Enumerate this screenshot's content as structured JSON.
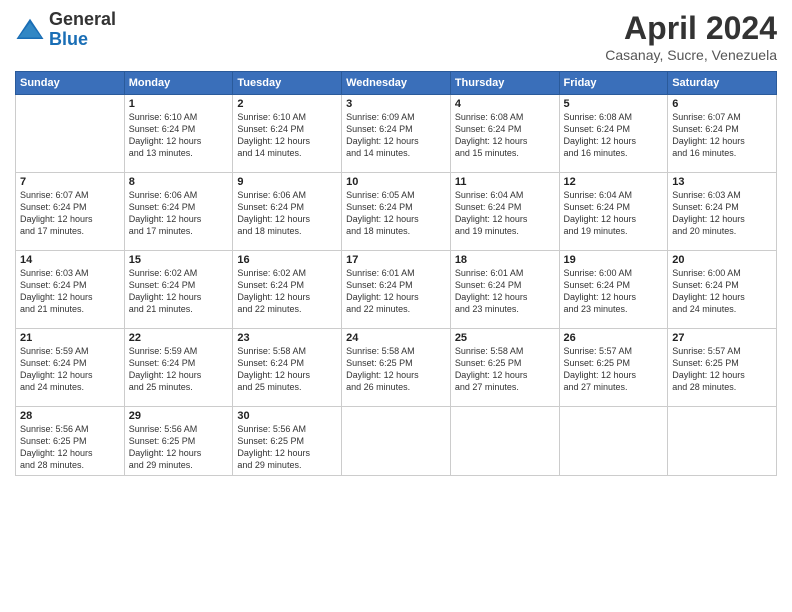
{
  "header": {
    "logo_general": "General",
    "logo_blue": "Blue",
    "title": "April 2024",
    "location": "Casanay, Sucre, Venezuela"
  },
  "weekdays": [
    "Sunday",
    "Monday",
    "Tuesday",
    "Wednesday",
    "Thursday",
    "Friday",
    "Saturday"
  ],
  "weeks": [
    [
      {
        "num": "",
        "empty": true
      },
      {
        "num": "1",
        "sunrise": "6:10 AM",
        "sunset": "6:24 PM",
        "daylight": "12 hours and 13 minutes."
      },
      {
        "num": "2",
        "sunrise": "6:10 AM",
        "sunset": "6:24 PM",
        "daylight": "12 hours and 14 minutes."
      },
      {
        "num": "3",
        "sunrise": "6:09 AM",
        "sunset": "6:24 PM",
        "daylight": "12 hours and 14 minutes."
      },
      {
        "num": "4",
        "sunrise": "6:08 AM",
        "sunset": "6:24 PM",
        "daylight": "12 hours and 15 minutes."
      },
      {
        "num": "5",
        "sunrise": "6:08 AM",
        "sunset": "6:24 PM",
        "daylight": "12 hours and 16 minutes."
      },
      {
        "num": "6",
        "sunrise": "6:07 AM",
        "sunset": "6:24 PM",
        "daylight": "12 hours and 16 minutes."
      }
    ],
    [
      {
        "num": "7",
        "sunrise": "6:07 AM",
        "sunset": "6:24 PM",
        "daylight": "12 hours and 17 minutes."
      },
      {
        "num": "8",
        "sunrise": "6:06 AM",
        "sunset": "6:24 PM",
        "daylight": "12 hours and 17 minutes."
      },
      {
        "num": "9",
        "sunrise": "6:06 AM",
        "sunset": "6:24 PM",
        "daylight": "12 hours and 18 minutes."
      },
      {
        "num": "10",
        "sunrise": "6:05 AM",
        "sunset": "6:24 PM",
        "daylight": "12 hours and 18 minutes."
      },
      {
        "num": "11",
        "sunrise": "6:04 AM",
        "sunset": "6:24 PM",
        "daylight": "12 hours and 19 minutes."
      },
      {
        "num": "12",
        "sunrise": "6:04 AM",
        "sunset": "6:24 PM",
        "daylight": "12 hours and 19 minutes."
      },
      {
        "num": "13",
        "sunrise": "6:03 AM",
        "sunset": "6:24 PM",
        "daylight": "12 hours and 20 minutes."
      }
    ],
    [
      {
        "num": "14",
        "sunrise": "6:03 AM",
        "sunset": "6:24 PM",
        "daylight": "12 hours and 21 minutes."
      },
      {
        "num": "15",
        "sunrise": "6:02 AM",
        "sunset": "6:24 PM",
        "daylight": "12 hours and 21 minutes."
      },
      {
        "num": "16",
        "sunrise": "6:02 AM",
        "sunset": "6:24 PM",
        "daylight": "12 hours and 22 minutes."
      },
      {
        "num": "17",
        "sunrise": "6:01 AM",
        "sunset": "6:24 PM",
        "daylight": "12 hours and 22 minutes."
      },
      {
        "num": "18",
        "sunrise": "6:01 AM",
        "sunset": "6:24 PM",
        "daylight": "12 hours and 23 minutes."
      },
      {
        "num": "19",
        "sunrise": "6:00 AM",
        "sunset": "6:24 PM",
        "daylight": "12 hours and 23 minutes."
      },
      {
        "num": "20",
        "sunrise": "6:00 AM",
        "sunset": "6:24 PM",
        "daylight": "12 hours and 24 minutes."
      }
    ],
    [
      {
        "num": "21",
        "sunrise": "5:59 AM",
        "sunset": "6:24 PM",
        "daylight": "12 hours and 24 minutes."
      },
      {
        "num": "22",
        "sunrise": "5:59 AM",
        "sunset": "6:24 PM",
        "daylight": "12 hours and 25 minutes."
      },
      {
        "num": "23",
        "sunrise": "5:58 AM",
        "sunset": "6:24 PM",
        "daylight": "12 hours and 25 minutes."
      },
      {
        "num": "24",
        "sunrise": "5:58 AM",
        "sunset": "6:25 PM",
        "daylight": "12 hours and 26 minutes."
      },
      {
        "num": "25",
        "sunrise": "5:58 AM",
        "sunset": "6:25 PM",
        "daylight": "12 hours and 27 minutes."
      },
      {
        "num": "26",
        "sunrise": "5:57 AM",
        "sunset": "6:25 PM",
        "daylight": "12 hours and 27 minutes."
      },
      {
        "num": "27",
        "sunrise": "5:57 AM",
        "sunset": "6:25 PM",
        "daylight": "12 hours and 28 minutes."
      }
    ],
    [
      {
        "num": "28",
        "sunrise": "5:56 AM",
        "sunset": "6:25 PM",
        "daylight": "12 hours and 28 minutes."
      },
      {
        "num": "29",
        "sunrise": "5:56 AM",
        "sunset": "6:25 PM",
        "daylight": "12 hours and 29 minutes."
      },
      {
        "num": "30",
        "sunrise": "5:56 AM",
        "sunset": "6:25 PM",
        "daylight": "12 hours and 29 minutes."
      },
      {
        "num": "",
        "empty": true
      },
      {
        "num": "",
        "empty": true
      },
      {
        "num": "",
        "empty": true
      },
      {
        "num": "",
        "empty": true
      }
    ]
  ]
}
